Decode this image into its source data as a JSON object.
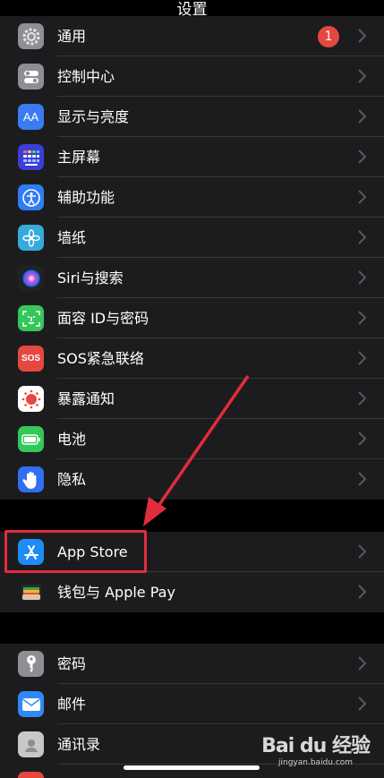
{
  "header": {
    "title": "设置"
  },
  "groups": [
    {
      "items": [
        {
          "label": "通用",
          "badge": "1",
          "icon": "gear-icon",
          "color": "#8e8e93"
        },
        {
          "label": "控制中心",
          "icon": "toggles-icon",
          "color": "#8e8e93"
        },
        {
          "label": "显示与亮度",
          "icon": "text-size-icon",
          "color": "#3a7bf0",
          "icon_text": "AA"
        },
        {
          "label": "主屏幕",
          "icon": "app-grid-icon",
          "color": "#3b3fd8"
        },
        {
          "label": "辅助功能",
          "icon": "accessibility-icon",
          "color": "#2f7cf6"
        },
        {
          "label": "墙纸",
          "icon": "flower-icon",
          "color": "#35aadc"
        },
        {
          "label": "Siri与搜索",
          "icon": "siri-icon",
          "color": "#222"
        },
        {
          "label": "面容 ID与密码",
          "icon": "face-id-icon",
          "color": "#34c759"
        },
        {
          "label": "SOS紧急联络",
          "icon": "sos-icon",
          "color": "#e5483f",
          "icon_text": "SOS"
        },
        {
          "label": "暴露通知",
          "icon": "exposure-icon",
          "color": "#ffffff"
        },
        {
          "label": "电池",
          "icon": "battery-icon",
          "color": "#34c759"
        },
        {
          "label": "隐私",
          "icon": "hand-icon",
          "color": "#2f6ff0"
        }
      ]
    },
    {
      "items": [
        {
          "label": "App Store",
          "icon": "app-store-icon",
          "color": "#1e8cf7"
        },
        {
          "label": "钱包与 Apple Pay",
          "icon": "wallet-icon",
          "color": "#1c1c1e"
        }
      ]
    },
    {
      "items": [
        {
          "label": "密码",
          "icon": "key-icon",
          "color": "#8e8e93"
        },
        {
          "label": "邮件",
          "icon": "mail-icon",
          "color": "#2f88f4"
        },
        {
          "label": "通讯录",
          "icon": "contacts-icon",
          "color": "#c8c8c8"
        }
      ]
    }
  ],
  "watermark": {
    "logo": "Bai du 经验",
    "sub": "jingyan.baidu.com"
  }
}
